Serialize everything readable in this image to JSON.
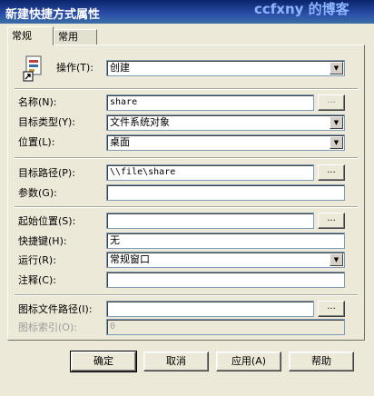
{
  "window": {
    "title": "新建快捷方式属性",
    "watermark": "ccfxny 的博客"
  },
  "tabs": [
    {
      "label": "常规"
    },
    {
      "label": "常用"
    }
  ],
  "form": {
    "operation_label": "操作(T):",
    "operation_value": "创建",
    "name_label": "名称(N):",
    "name_value": "share",
    "target_type_label": "目标类型(Y):",
    "target_type_value": "文件系统对象",
    "location_label": "位置(L):",
    "location_value": "桌面",
    "target_path_label": "目标路径(P):",
    "target_path_value": "\\\\file\\share",
    "arguments_label": "参数(G):",
    "arguments_value": "",
    "start_in_label": "起始位置(S):",
    "start_in_value": "",
    "shortcut_key_label": "快捷键(H):",
    "shortcut_key_value": "无",
    "run_label": "运行(R):",
    "run_value": "常规窗口",
    "comment_label": "注释(C):",
    "comment_value": "",
    "icon_path_label": "图标文件路径(I):",
    "icon_path_value": "",
    "icon_index_label": "图标索引(O):",
    "icon_index_value": "0",
    "browse_label": "..."
  },
  "buttons": {
    "ok": "确定",
    "cancel": "取消",
    "apply": "应用(A)",
    "help": "帮助"
  }
}
